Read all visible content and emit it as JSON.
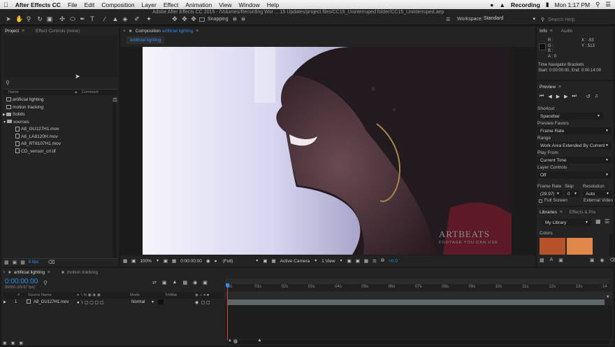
{
  "menubar": {
    "app_name": "After Effects CC",
    "items": [
      "File",
      "Edit",
      "Composition",
      "Layer",
      "Effect",
      "Animation",
      "View",
      "Window",
      "Help"
    ],
    "recording": "Recording",
    "time": "Mon 1:17 PM"
  },
  "window": {
    "title": "Adobe After Effects CC 2015 - /Volumes/Recording Wor ... 15 Updates/project files/CC15_Uninterruped folder/CC15_Uninterruped.aep"
  },
  "toolbar": {
    "snapping": "Snapping",
    "workspace_label": "Workspace:",
    "workspace_value": "Standard",
    "search_help": "Search Help"
  },
  "project": {
    "tab": "Project",
    "effect_controls_tab": "Effect Controls (none)",
    "col_name": "Name",
    "col_comment": "Comment",
    "items": [
      {
        "type": "comp",
        "label": "artificial lighting",
        "indent": 0
      },
      {
        "type": "comp",
        "label": "motion tracking",
        "indent": 0
      },
      {
        "type": "folder",
        "label": "Solids",
        "indent": 0
      },
      {
        "type": "folder",
        "label": "sources",
        "indent": 0
      },
      {
        "type": "file",
        "label": "A8_GU127H1.mov",
        "indent": 1
      },
      {
        "type": "file",
        "label": "A8_LA8120H.mov",
        "indent": 1
      },
      {
        "type": "file",
        "label": "A8_RT8107H1.mov",
        "indent": 1
      },
      {
        "type": "file",
        "label": "CD_sensor_crl.tif",
        "indent": 1
      }
    ],
    "bpc": "8 bpc"
  },
  "composition": {
    "tab_prefix": "Composition",
    "tab_name": "artificial lighting",
    "flow_tab": "artificial lighting",
    "watermark_1": "ARTBEATS",
    "watermark_2": "FOOTAGE YOU CAN USE",
    "zoom": "100%",
    "timecode": "0:00:00:00",
    "resolution": "(Full)",
    "camera": "Active Camera",
    "views": "1 View",
    "exposure": "+0.0"
  },
  "info": {
    "tab": "Info",
    "audio_tab": "Audio",
    "r": "R :",
    "g": "G :",
    "b": "B :",
    "a": "A : 0",
    "x": "X : -53",
    "y": "Y : 513",
    "nav_title": "Time Navigator Brackets",
    "nav_range": "Start: 0:00:00:00, End: 0:00:14:00"
  },
  "preview": {
    "tab": "Preview",
    "shortcut_label": "Shortcut",
    "shortcut_value": "Spacebar",
    "favors_label": "Preview Favors",
    "favors_value": "Frame Rate",
    "range_label": "Range",
    "range_value": "Work Area Extended By Current",
    "playfrom_label": "Play From",
    "playfrom_value": "Current Time",
    "layerctl_label": "Layer Controls",
    "layerctl_value": "Off",
    "framerate_label": "Frame Rate",
    "skip_label": "Skip",
    "resolution_label": "Resolution",
    "framerate_value": "(29.97)",
    "skip_value": "0",
    "resolution_value": "Auto",
    "fullscreen": "Full Screen",
    "external_video": "External Video"
  },
  "libraries": {
    "tab": "Libraries",
    "effects_tab": "Effects & Pre",
    "library": "My Library",
    "colors_label": "Colors",
    "swatch_1": "#b4532a",
    "swatch_2": "#e0874b"
  },
  "timeline": {
    "tab_active": "artificial lighting",
    "tab_other": "motion tracking",
    "timecode": "0:00:00:00",
    "fps": "00000 (29.97 fps)",
    "col_num": "#",
    "col_source": "Source Name",
    "col_mode": "Mode",
    "col_trkmat": "TrkMat",
    "layer_num": "1",
    "layer_name": "A8_GU127H1.mov",
    "layer_mode": "Normal",
    "ticks": [
      "0s",
      "01s",
      "02s",
      "03s",
      "04s",
      "05s",
      "06s",
      "07s",
      "08s",
      "09s",
      "10s",
      "11s",
      "12s",
      "13s",
      "14"
    ]
  },
  "colors": {
    "accent": "#2d8ceb",
    "panel": "#232323"
  }
}
